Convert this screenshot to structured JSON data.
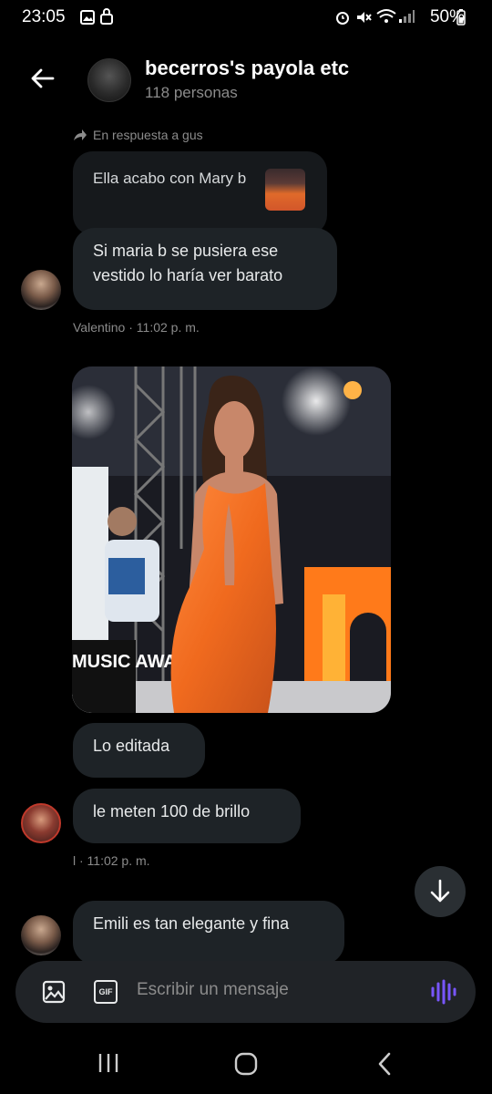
{
  "status": {
    "time": "23:05",
    "battery": "50%"
  },
  "header": {
    "title": "becerros's payola etc",
    "subtitle": "118 personas"
  },
  "thread": {
    "reply_label": "En respuesta a gus",
    "quoted_text": "Ella acabo con Mary b",
    "messages": [
      {
        "text": "Si maria b se pusiera ese vestido lo haría ver barato"
      },
      {
        "text": "Lo editada"
      },
      {
        "text": "le meten 100 de brillo"
      },
      {
        "text": "Emili es tan elegante y fina"
      }
    ],
    "meta1": "Valentino · 11:02 p. m.",
    "meta2": "l · 11:02 p. m.",
    "photo_text": "MUSIC AWARDS"
  },
  "composer": {
    "placeholder": "Escribir un mensaje",
    "gif_label": "GIF"
  },
  "colors": {
    "accent": "#7856ff",
    "bubble": "#1e2327",
    "background": "#000000"
  }
}
